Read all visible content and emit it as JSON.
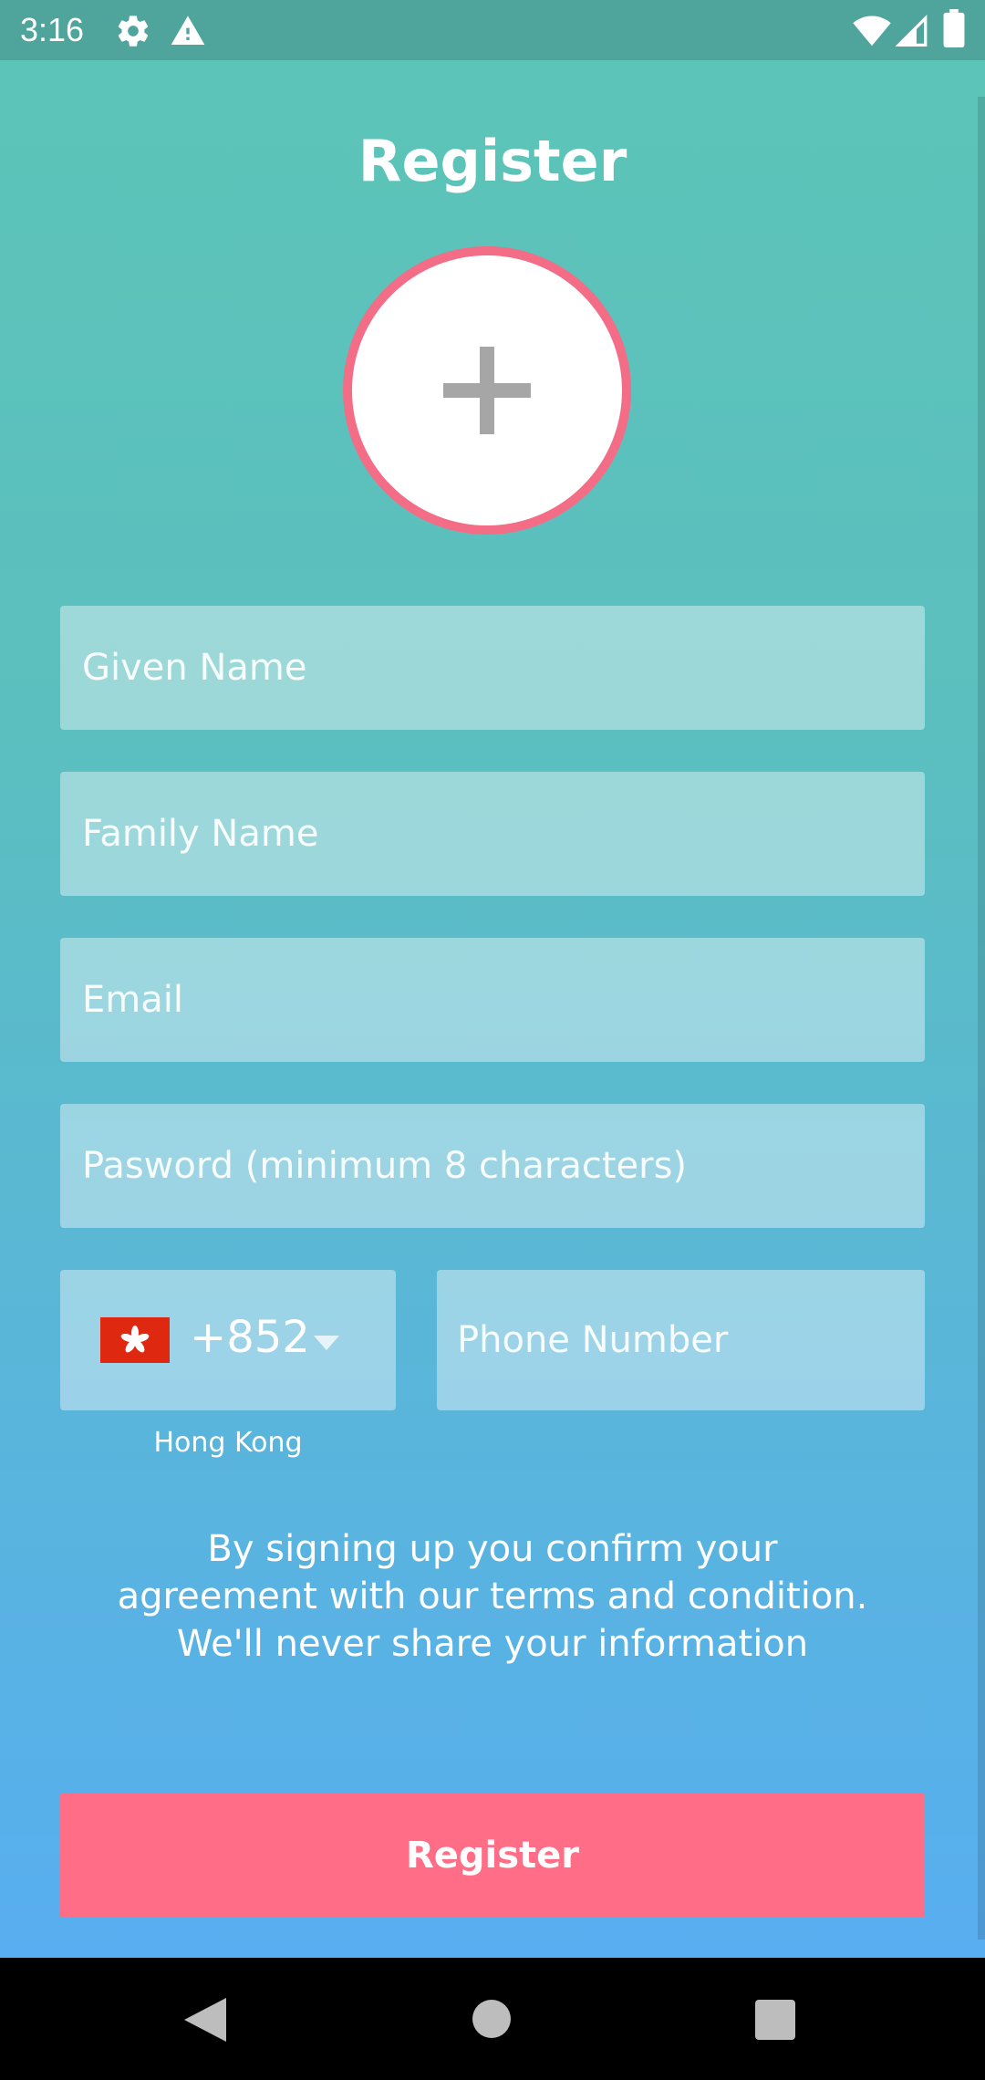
{
  "status_bar": {
    "time": "3:16",
    "icons": [
      "gear-icon",
      "alert-icon",
      "wifi-icon",
      "signal-icon",
      "battery-icon"
    ]
  },
  "page": {
    "title": "Register"
  },
  "avatar": {
    "icon": "plus-icon",
    "border_color": "#f26d85"
  },
  "form": {
    "given_name_placeholder": "Given Name",
    "family_name_placeholder": "Family Name",
    "email_placeholder": "Email",
    "password_placeholder": "Pasword (minimum 8 characters)",
    "country": {
      "dial_code": "+852",
      "name": "Hong Kong",
      "flag_icon": "hong-kong-flag-icon"
    },
    "phone_placeholder": "Phone Number"
  },
  "terms": {
    "line1": "By signing up you confirm your",
    "line2": "agreement with our terms and condition.",
    "line3": "We'll never share your information"
  },
  "register_button": {
    "label": "Register",
    "color": "#ff6e86"
  },
  "nav_bar": {
    "icons": [
      "back-icon",
      "home-icon",
      "recents-icon"
    ]
  }
}
